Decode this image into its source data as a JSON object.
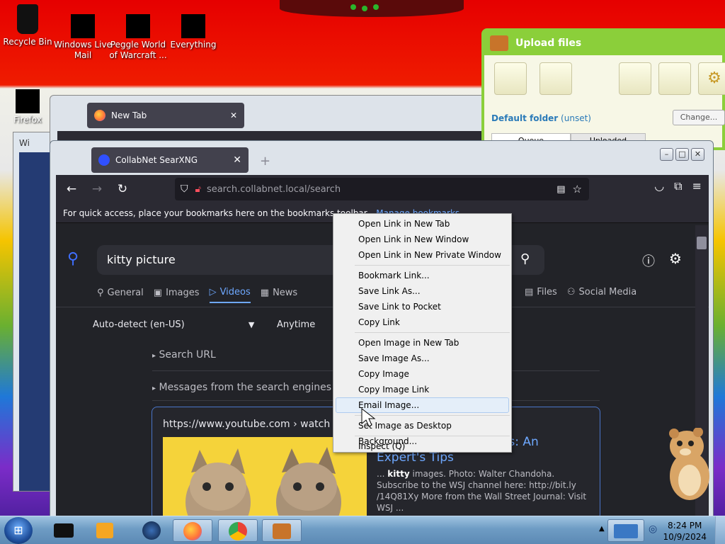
{
  "desktop": {
    "icons": [
      {
        "label": "Recycle Bin"
      },
      {
        "label": "Windows Live Mail"
      },
      {
        "label": "Peggle World of Warcraft ..."
      },
      {
        "label": "Everything"
      },
      {
        "label": "Firefox"
      }
    ],
    "partial_window_title": "Wi"
  },
  "upload_window": {
    "title": "Upload files",
    "folder_label": "Default folder",
    "folder_value": "(unset)",
    "change_button": "Change...",
    "tabs": [
      "Queue",
      "Uploaded"
    ]
  },
  "bg_firefox": {
    "tab_label": "New Tab"
  },
  "firefox": {
    "tab_label": "CollabNet SearXNG",
    "url_host": "search.collabnet.local",
    "url_path": "/search",
    "bookmarks_hint": "For quick access, place your bookmarks here on the bookmarks toolbar.",
    "bookmarks_link": "Manage bookmarks..."
  },
  "search": {
    "query": "kitty picture",
    "categories": [
      {
        "label": "General",
        "icon": "search-icon"
      },
      {
        "label": "Images",
        "icon": "image-icon"
      },
      {
        "label": "Videos",
        "icon": "play-icon",
        "active": true
      },
      {
        "label": "News",
        "icon": "newspaper-icon"
      },
      {
        "label": "Files",
        "icon": "files-icon"
      },
      {
        "label": "Social Media",
        "icon": "people-icon"
      }
    ],
    "language": "Auto-detect (en-US)",
    "time_range": "Anytime",
    "search_url_label": "Search URL",
    "messages_label": "Messages from the search engines"
  },
  "result": {
    "url": "https://www.youtube.com",
    "path": "› watch",
    "title": "os: An Expert's Tips",
    "snippet_prefix": "...",
    "snippet_bold": "kitty",
    "snippet_rest": "images. Photo: Walter Chandoha. Subscribe to the WSJ channel here: http://bit.ly /14Q81Xy More from the Wall Street Journal: Visit WSJ ..."
  },
  "context_menu": {
    "items": [
      "Open Link in New Tab",
      "Open Link in New Window",
      "Open Link in New Private Window",
      "Bookmark Link...",
      "Save Link As...",
      "Save Link to Pocket",
      "Copy Link",
      "Open Image in New Tab",
      "Save Image As...",
      "Copy Image",
      "Copy Image Link",
      "Email Image...",
      "Set Image as Desktop Background...",
      "Inspect (Q)"
    ],
    "highlighted": "Email Image..."
  },
  "taskbar": {
    "time": "8:24 PM",
    "date": "10/9/2024"
  },
  "colors": {
    "ff_dark": "#2b2a33",
    "accent_blue": "#6ea8ff",
    "upload_green": "#8bcf3a"
  }
}
